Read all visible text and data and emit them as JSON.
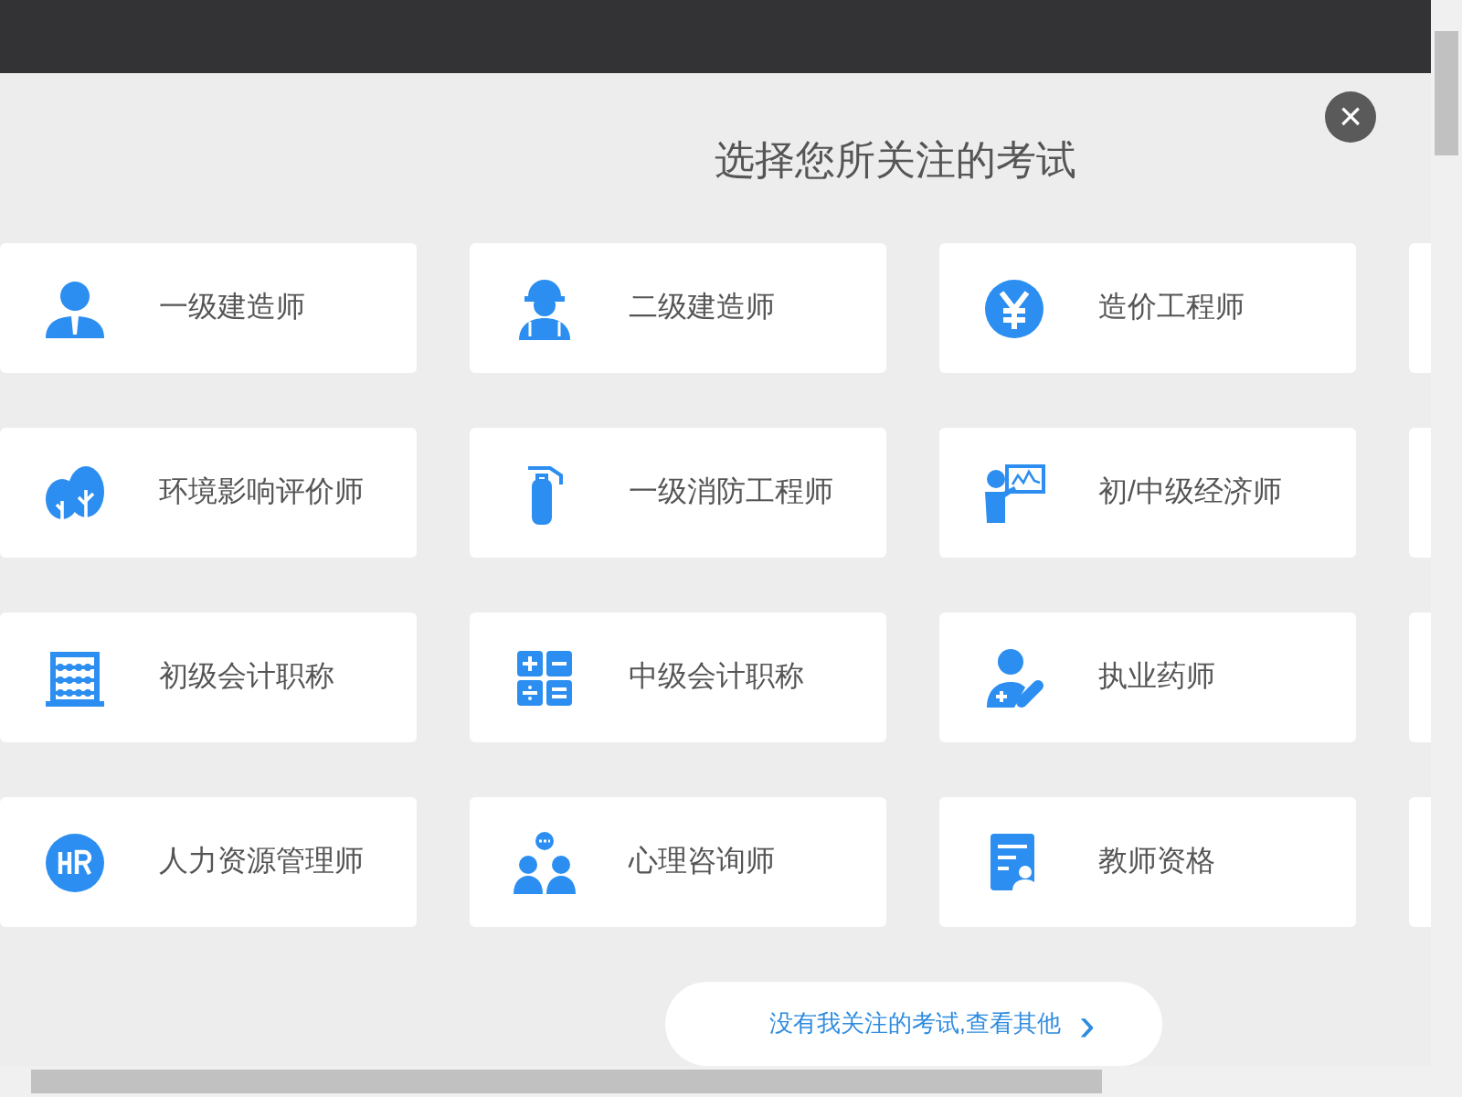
{
  "dialog": {
    "title": "选择您所关注的考试",
    "close_label": "×"
  },
  "exams": [
    {
      "label": "一级建造师"
    },
    {
      "label": "二级建造师"
    },
    {
      "label": "造价工程师"
    },
    {
      "label": "环境影响评价师"
    },
    {
      "label": "一级消防工程师"
    },
    {
      "label": "初/中级经济师"
    },
    {
      "label": "初级会计职称"
    },
    {
      "label": "中级会计职称"
    },
    {
      "label": "执业药师"
    },
    {
      "label": "人力资源管理师"
    },
    {
      "label": "心理咨询师"
    },
    {
      "label": "教师资格"
    }
  ],
  "more_button": {
    "label": "没有我关注的考试,查看其他",
    "arrow": "›"
  }
}
